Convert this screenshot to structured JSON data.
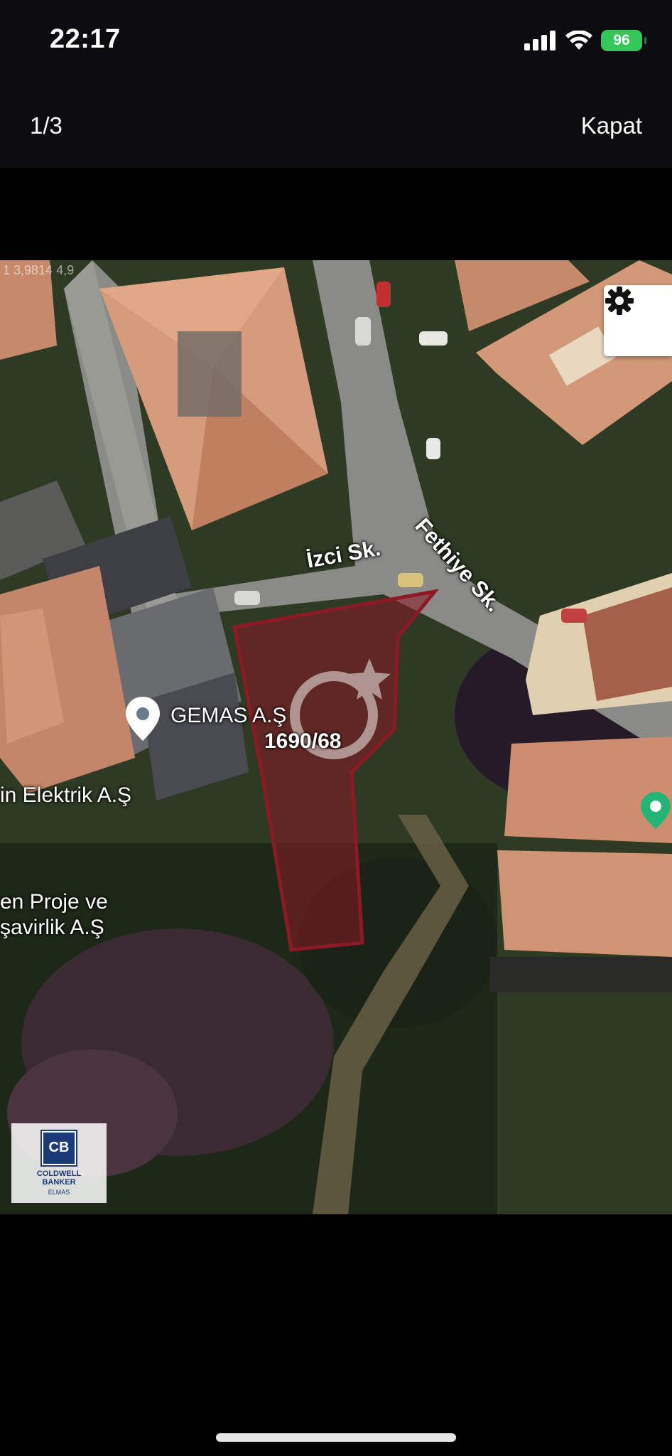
{
  "status_bar": {
    "time": "22:17",
    "battery": "96",
    "icons": [
      "cellular-signal-icon",
      "wifi-icon",
      "battery-icon"
    ]
  },
  "viewer": {
    "counter": "1/3",
    "close_label": "Kapat"
  },
  "map": {
    "coordinates": "1 3,9814 4,9",
    "settings_icon": "gear-icon",
    "streets": {
      "izci": "İzci Sk.",
      "fethiye": "Fethiye Sk."
    },
    "places": {
      "gemas": "GEMAS A.Ş",
      "elektrik": "in Elektrik A.Ş",
      "proje_line1": "en Proje ve",
      "proje_line2": "şavirlik A.Ş"
    },
    "parcel": "1690/68",
    "parcel_color": "#8b1a24",
    "pin_color": "#22b574"
  },
  "brand": {
    "mark": "CB",
    "name_line1": "COLDWELL",
    "name_line2": "BANKER",
    "sub": "ELMAS"
  }
}
